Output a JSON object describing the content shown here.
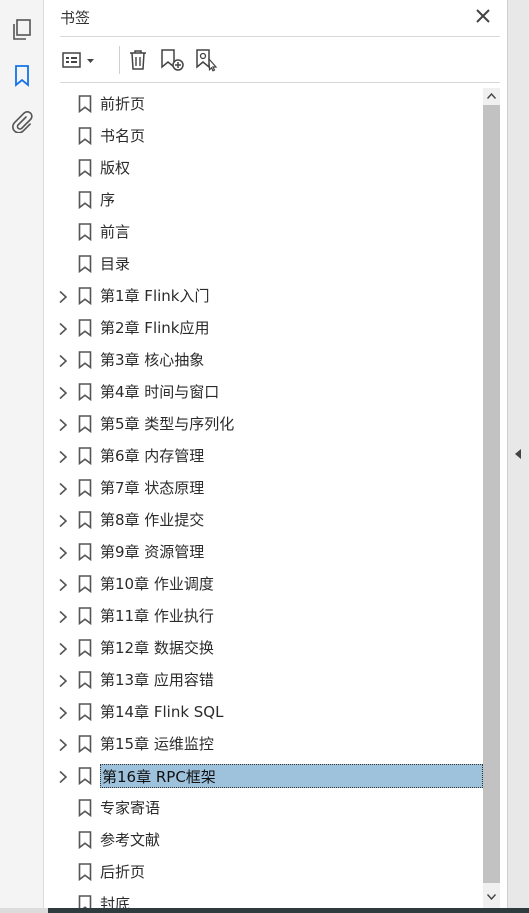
{
  "panel": {
    "title": "书签"
  },
  "bookmarks": [
    {
      "label": "前折页",
      "expandable": false
    },
    {
      "label": "书名页",
      "expandable": false
    },
    {
      "label": "版权",
      "expandable": false
    },
    {
      "label": "序",
      "expandable": false
    },
    {
      "label": "前言",
      "expandable": false
    },
    {
      "label": "目录",
      "expandable": false
    },
    {
      "label": "第1章 Flink入门",
      "expandable": true
    },
    {
      "label": "第2章 Flink应用",
      "expandable": true
    },
    {
      "label": "第3章 核心抽象",
      "expandable": true
    },
    {
      "label": "第4章 时间与窗口",
      "expandable": true
    },
    {
      "label": "第5章 类型与序列化",
      "expandable": true
    },
    {
      "label": "第6章 内存管理",
      "expandable": true
    },
    {
      "label": "第7章 状态原理",
      "expandable": true
    },
    {
      "label": "第8章 作业提交",
      "expandable": true
    },
    {
      "label": "第9章 资源管理",
      "expandable": true
    },
    {
      "label": "第10章 作业调度",
      "expandable": true
    },
    {
      "label": "第11章 作业执行",
      "expandable": true
    },
    {
      "label": "第12章 数据交换",
      "expandable": true
    },
    {
      "label": "第13章 应用容错",
      "expandable": true
    },
    {
      "label": "第14章 Flink SQL",
      "expandable": true
    },
    {
      "label": "第15章 运维监控",
      "expandable": true
    },
    {
      "label": "第16章 RPC框架",
      "expandable": true,
      "selected": true
    },
    {
      "label": "专家寄语",
      "expandable": false
    },
    {
      "label": "参考文献",
      "expandable": false
    },
    {
      "label": "后折页",
      "expandable": false
    },
    {
      "label": "封底",
      "expandable": false
    }
  ],
  "colors": {
    "selection": "#9ec1dc",
    "active_rail_icon": "#1473e6"
  },
  "icons": {
    "rail": [
      "pages-icon",
      "bookmark-icon",
      "attachment-icon"
    ],
    "toolbar": [
      "options-menu-icon",
      "delete-icon",
      "new-bookmark-icon",
      "bookmark-from-selection-icon"
    ]
  }
}
